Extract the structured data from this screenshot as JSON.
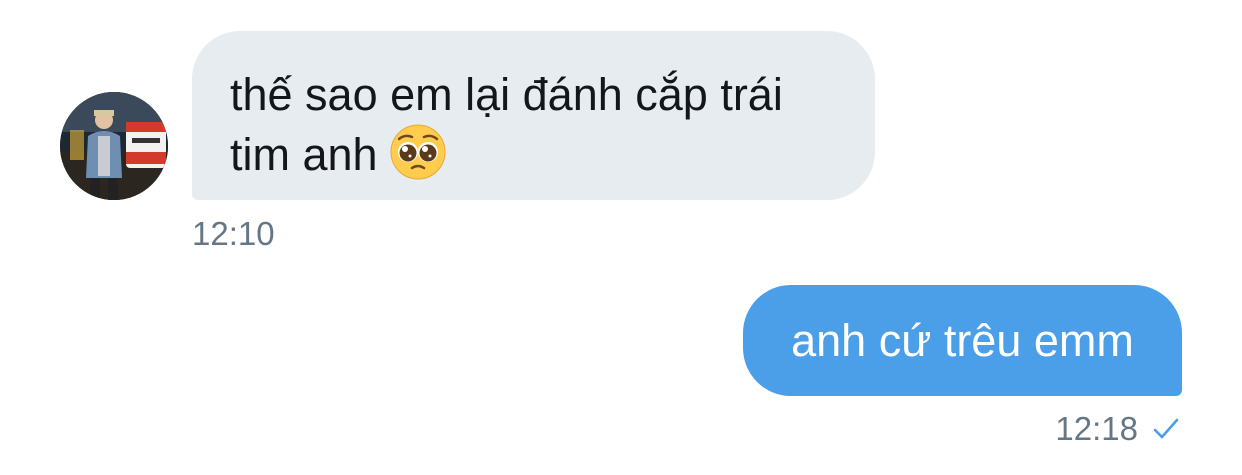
{
  "conversation": {
    "incoming": {
      "lines": [
        "thế sao em lại đánh cắp trái",
        "tim anh"
      ],
      "emoji": "pleading-face",
      "time": "12:10"
    },
    "outgoing": {
      "text": "anh cứ trêu emm",
      "time": "12:18",
      "status_icon": "check-icon"
    }
  },
  "colors": {
    "incoming_bubble": "#e6ecf0",
    "outgoing_bubble": "#4b9ee8",
    "timestamp": "#657786",
    "check": "#4b9ee8"
  }
}
